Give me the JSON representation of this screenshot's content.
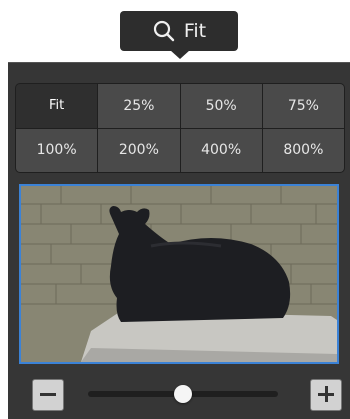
{
  "zoom_button": {
    "label": "Fit",
    "icon": "search-icon"
  },
  "zoom_options": [
    {
      "label": "Fit",
      "active": true
    },
    {
      "label": "25%",
      "active": false
    },
    {
      "label": "50%",
      "active": false
    },
    {
      "label": "75%",
      "active": false
    },
    {
      "label": "100%",
      "active": false
    },
    {
      "label": "200%",
      "active": false
    },
    {
      "label": "400%",
      "active": false
    },
    {
      "label": "800%",
      "active": false
    }
  ],
  "preview": {
    "subject": "bear"
  },
  "slider": {
    "value": 0.5,
    "minus_icon": "minus-icon",
    "plus_icon": "plus-icon"
  },
  "colors": {
    "accent": "#3b82d6",
    "popover_bg": "#363636",
    "button_bg": "#2d2d2d"
  }
}
